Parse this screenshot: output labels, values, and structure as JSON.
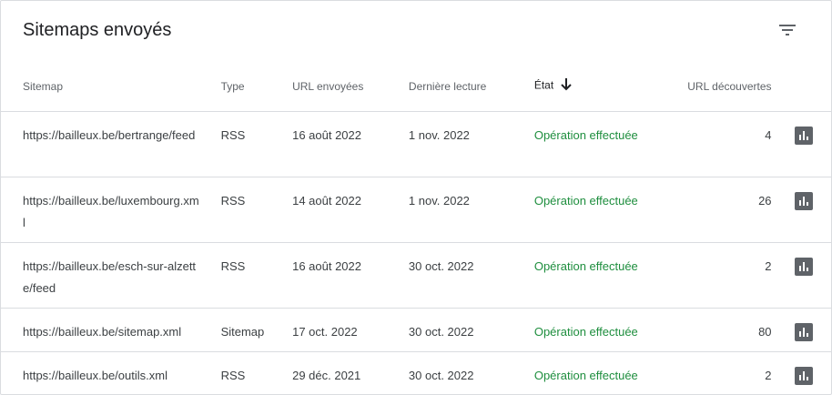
{
  "card": {
    "title": "Sitemaps envoyés",
    "filter_icon": "filter-list-icon"
  },
  "table": {
    "columns": {
      "sitemap": "Sitemap",
      "type": "Type",
      "url_sent": "URL envoyées",
      "last_read": "Dernière lecture",
      "state": "État",
      "discovered": "URL découvertes"
    },
    "sort_icon": "arrow-downward-icon",
    "rows": [
      {
        "sitemap": "https://bailleux.be/bertrange/feed",
        "type": "RSS",
        "submitted": "16 août 2022",
        "last_read": "1 nov. 2022",
        "state": "Opération effectuée",
        "discovered": "4"
      },
      {
        "sitemap": "https://bailleux.be/luxembourg.xml",
        "type": "RSS",
        "submitted": "14 août 2022",
        "last_read": "1 nov. 2022",
        "state": "Opération effectuée",
        "discovered": "26"
      },
      {
        "sitemap": "https://bailleux.be/esch-sur-alzette/feed",
        "type": "RSS",
        "submitted": "16 août 2022",
        "last_read": "30 oct. 2022",
        "state": "Opération effectuée",
        "discovered": "2"
      },
      {
        "sitemap": "https://bailleux.be/sitemap.xml",
        "type": "Sitemap",
        "submitted": "17 oct. 2022",
        "last_read": "30 oct. 2022",
        "state": "Opération effectuée",
        "discovered": "80"
      },
      {
        "sitemap": "https://bailleux.be/outils.xml",
        "type": "RSS",
        "submitted": "29 déc. 2021",
        "last_read": "30 oct. 2022",
        "state": "Opération effectuée",
        "discovered": "2"
      }
    ],
    "row_action_icon": "bar-chart-icon"
  },
  "colors": {
    "success": "#1e8e3e",
    "text": "#3c4043",
    "header_text": "#5f6368",
    "divider": "#dadce0"
  }
}
